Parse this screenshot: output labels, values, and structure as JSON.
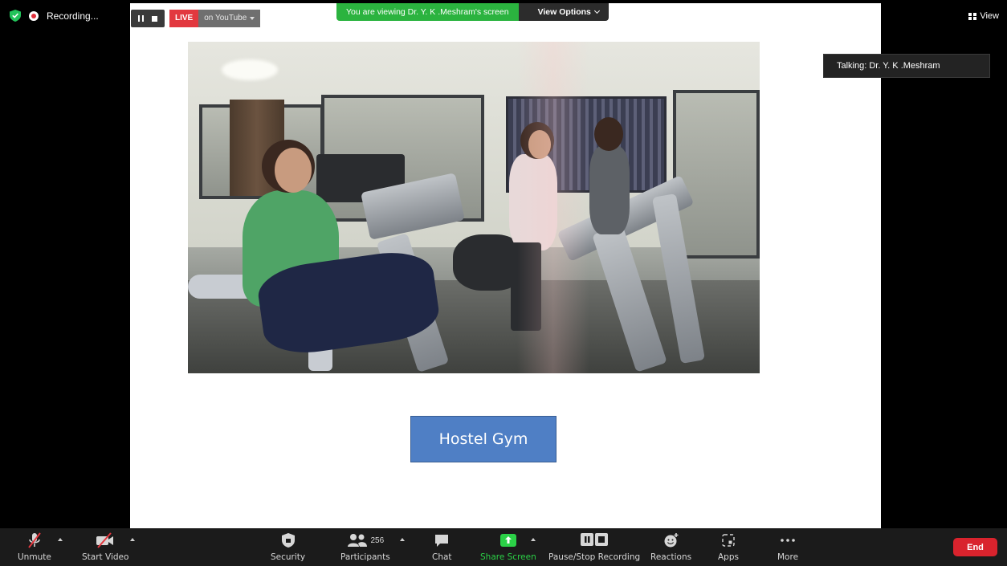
{
  "status": {
    "recording_label": "Recording...",
    "live_label": "LIVE",
    "youtube_label": "on YouTube"
  },
  "banner": {
    "viewing_text": "You are viewing Dr. Y. K .Meshram's screen",
    "view_options_label": "View Options"
  },
  "view_button_label": "View",
  "talking_text": "Talking: Dr. Y. K .Meshram",
  "slide": {
    "caption": "Hostel Gym"
  },
  "toolbar": {
    "unmute_label": "Unmute",
    "start_video_label": "Start Video",
    "security_label": "Security",
    "participants_label": "Participants",
    "participants_count": "256",
    "chat_label": "Chat",
    "share_screen_label": "Share Screen",
    "pause_stop_label": "Pause/Stop Recording",
    "reactions_label": "Reactions",
    "apps_label": "Apps",
    "more_label": "More",
    "end_label": "End"
  },
  "colors": {
    "accent_green": "#2bb33f",
    "live_red": "#e2383f",
    "end_red": "#d9232d",
    "caption_blue": "#4f7fc5"
  }
}
